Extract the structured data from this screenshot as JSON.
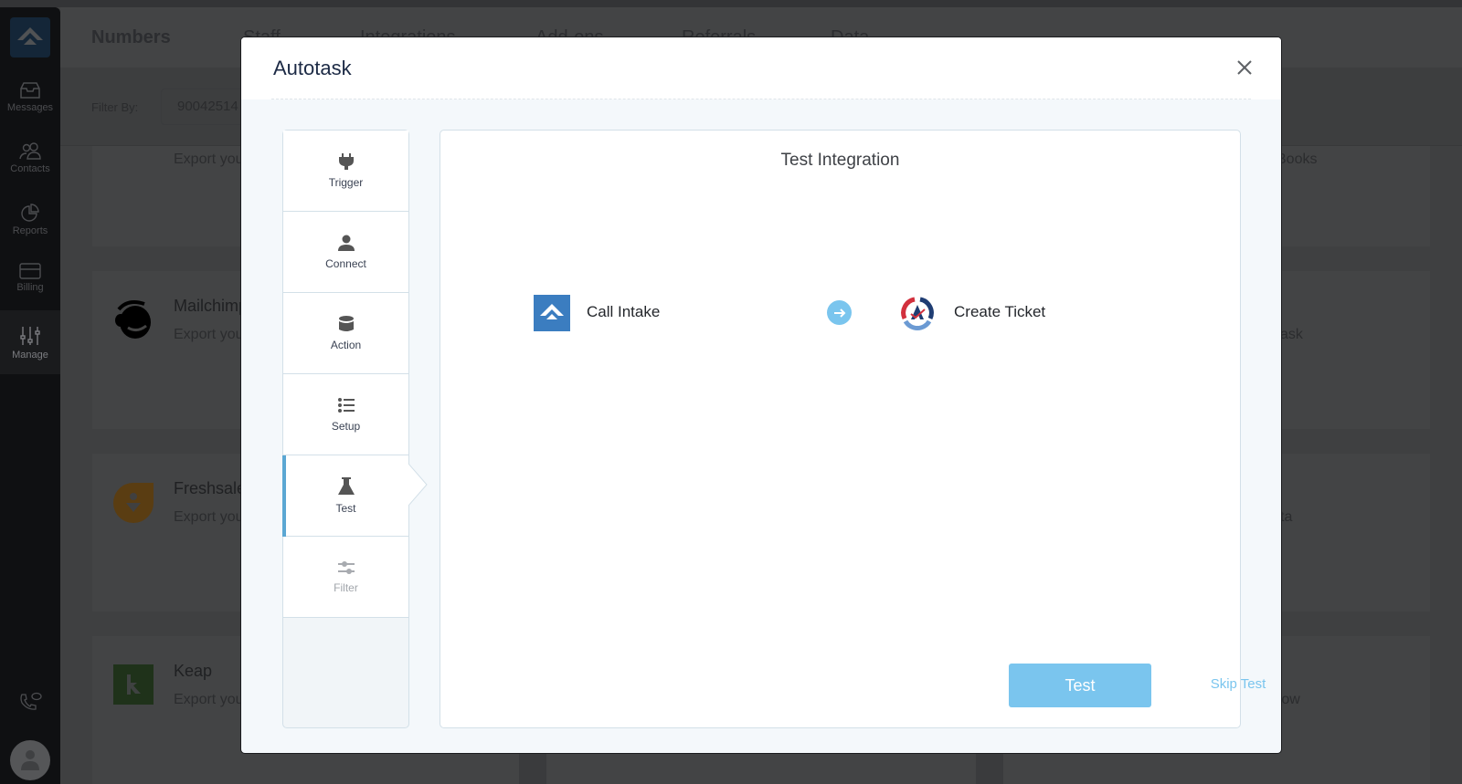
{
  "background": {
    "sidebar": {
      "items": [
        {
          "label": "Messages",
          "icon": "inbox-icon"
        },
        {
          "label": "Contacts",
          "icon": "contacts-icon"
        },
        {
          "label": "Reports",
          "icon": "pie-chart-icon"
        },
        {
          "label": "Billing",
          "icon": "credit-card-icon"
        },
        {
          "label": "Manage",
          "icon": "sliders-icon",
          "active": true
        }
      ]
    },
    "tabs": [
      "Numbers",
      "Staff",
      "Integrations",
      "Add-ons",
      "Referrals",
      "Data"
    ],
    "filter": {
      "label": "Filter By:",
      "value": "90042514"
    },
    "cards": [
      {
        "title": "",
        "desc": "Export you",
        "right": "Books"
      },
      {
        "title": "Mailchimp",
        "desc": "Export you",
        "right": "ask"
      },
      {
        "title": "Freshsales",
        "desc": "Export you",
        "right": "ta"
      },
      {
        "title": "Keap",
        "desc": "Export you",
        "right": "row"
      }
    ]
  },
  "modal": {
    "title": "Autotask",
    "steps": [
      {
        "label": "Trigger",
        "icon": "plug-icon",
        "state": "done"
      },
      {
        "label": "Connect",
        "icon": "user-icon",
        "state": "done"
      },
      {
        "label": "Action",
        "icon": "database-icon",
        "state": "done"
      },
      {
        "label": "Setup",
        "icon": "list-icon",
        "state": "done"
      },
      {
        "label": "Test",
        "icon": "flask-icon",
        "state": "active"
      },
      {
        "label": "Filter",
        "icon": "filter-sliders-icon",
        "state": "disabled"
      }
    ],
    "panel": {
      "title": "Test Integration",
      "source": {
        "label": "Call Intake"
      },
      "destination": {
        "label": "Create Ticket"
      },
      "test_button": "Test",
      "skip_button": "Skip Test"
    }
  },
  "colors": {
    "accent": "#7ac5ee",
    "active_step_bar": "#5ba7d3",
    "source_brand": "#3b7dc0"
  }
}
